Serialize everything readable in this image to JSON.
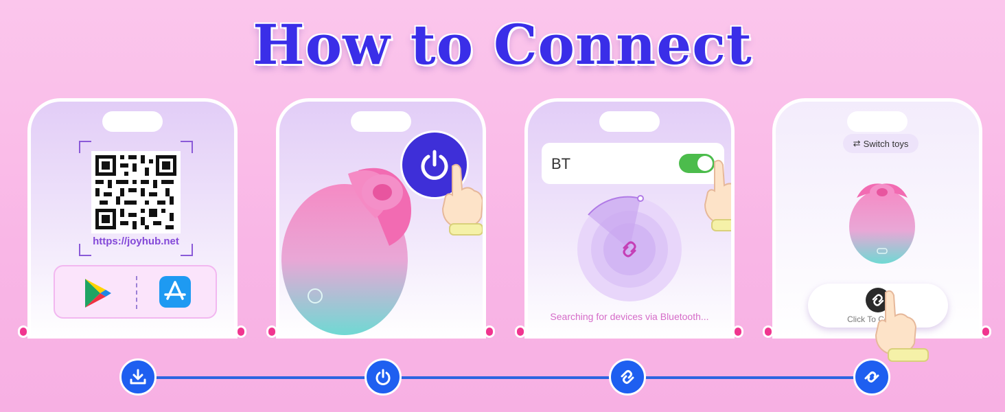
{
  "title": "How to Connect",
  "steps": [
    {
      "name": "download",
      "icon": "download-icon",
      "qr_url": "https://joyhub.net",
      "stores": [
        "google-play-icon",
        "app-store-icon"
      ]
    },
    {
      "name": "power-on",
      "icon": "power-icon"
    },
    {
      "name": "bluetooth",
      "icon": "link-icon",
      "bt_label": "BT",
      "toggle_on": true,
      "status_text": "Searching for devices via Bluetooth..."
    },
    {
      "name": "connect",
      "icon": "link-icon",
      "switch_label": "Switch toys",
      "connect_label": "Click To Connect"
    }
  ],
  "colors": {
    "title": "#3a2ee8",
    "accent": "#1e5ff0",
    "toggle": "#4cbc4c",
    "toy_pink": "#f58ac4",
    "toy_teal": "#7ad9d6"
  }
}
